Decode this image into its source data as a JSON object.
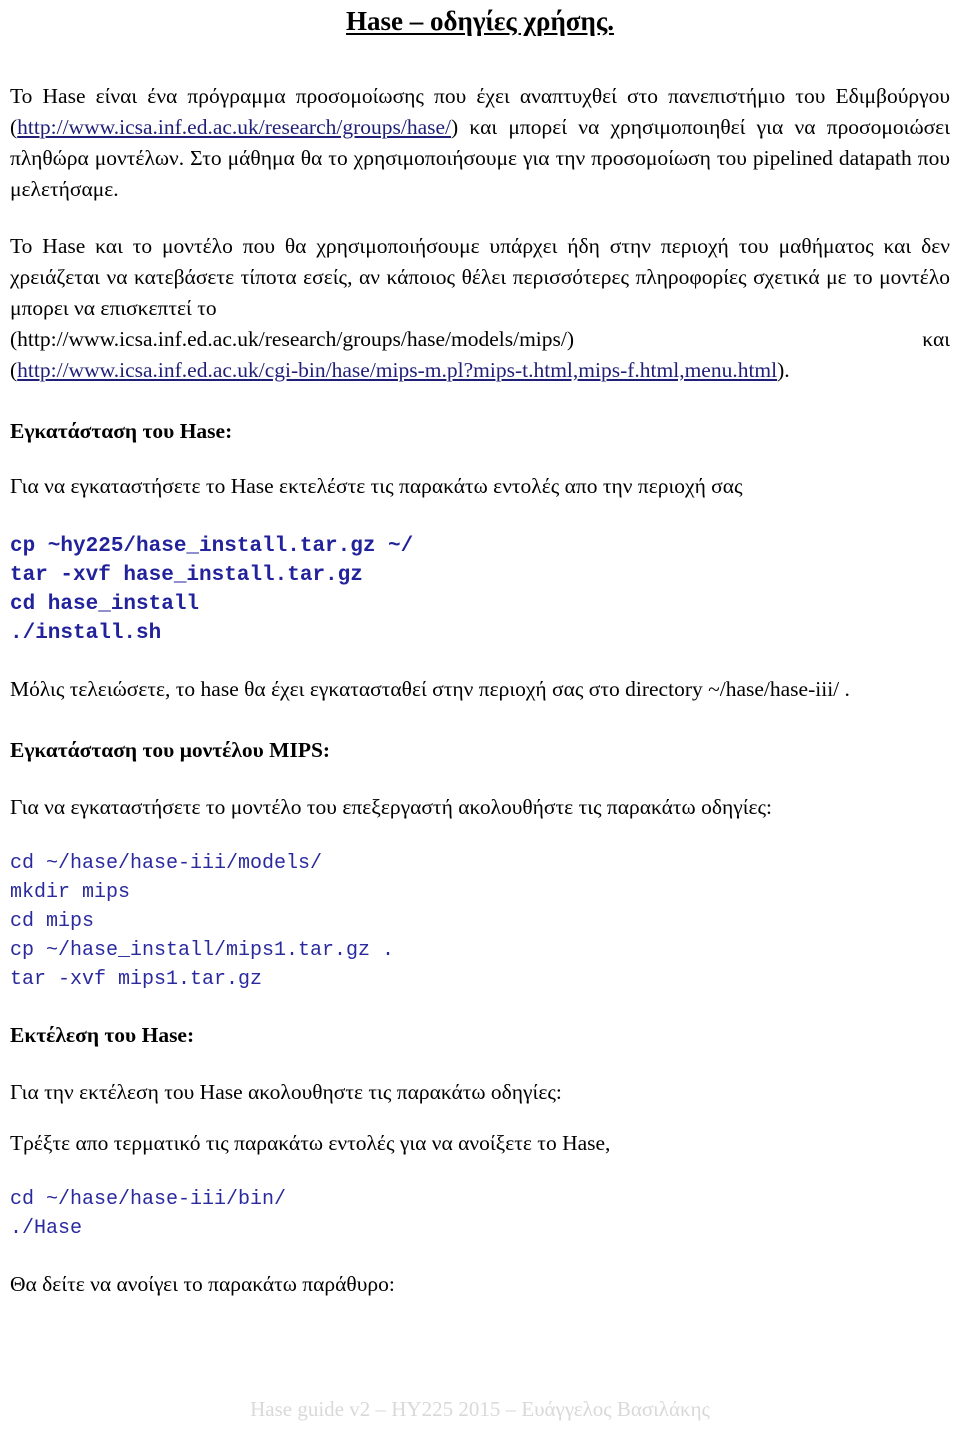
{
  "document": {
    "title": "Hase – οδηγίες χρήσης."
  },
  "intro": {
    "part1": "Το Hase είναι ένα πρόγραμμα προσομοίωσης που έχει αναπτυχθεί στο πανεπιστήμιο του Εδιμβούργου (",
    "link1": "http://www.icsa.inf.ed.ac.uk/research/groups/hase/",
    "part2": ") και μπορεί να χρησιμοποιηθεί για να προσομοιώσει πληθώρα μοντέλων. Στο μάθημα θα το χρησιμοποιήσουμε για την προσομοίωση του pipelined datapath που μελετήσαμε."
  },
  "model_info": {
    "part1": "Το Hase και το μοντέλο που θα χρησιμοποιήσουμε υπάρχει ήδη στην περιοχή του μαθήματος και δεν χρειάζεται να κατεβάσετε τίποτα εσείς, αν κάποιος θέλει περισσότερες πληροφορίες σχετικά με το μοντέλο μπορει να επισκεπτεί το",
    "url_plain": "(http://www.icsa.inf.ed.ac.uk/research/groups/hase/models/mips/)",
    "connector": "και",
    "url_link": "http://www.icsa.inf.ed.ac.uk/cgi-bin/hase/mips-m.pl?mips-t.html,mips-f.html,menu.html",
    "url_open_paren": "(",
    "url_close_paren": ")."
  },
  "install_hase": {
    "heading": "Εγκατάσταση του Hase:",
    "instruction": "Για να εγκαταστήσετε το Hase εκτελέστε τις παρακάτω εντολές απο την περιοχή σας",
    "commands": [
      "cp ~hy225/hase_install.tar.gz ~/",
      "tar -xvf hase_install.tar.gz",
      "cd hase_install",
      "./install.sh"
    ],
    "after": "Μόλις τελειώσετε, το hase θα έχει εγκατασταθεί στην περιοχή σας στο directory ~/hase/hase-iii/ ."
  },
  "install_mips": {
    "heading": "Εγκατάσταση του μοντέλου MIPS:",
    "instruction": "Για να εγκαταστήσετε το μοντέλο του επεξεργαστή ακολουθήστε τις παρακάτω οδηγίες:",
    "commands": [
      "cd ~/hase/hase-iii/models/",
      "mkdir mips",
      "cd mips",
      "cp ~/hase_install/mips1.tar.gz .",
      "tar -xvf mips1.tar.gz"
    ]
  },
  "run_hase": {
    "heading": "Εκτέλεση του Hase:",
    "instruction": "Για την εκτέλεση του Hase ακολουθηστε τις παρακάτω οδηγίες:",
    "terminal_note": "Τρέξτε απο τερματικό τις παρακάτω εντολές για να ανοίξετε το Hase,",
    "commands": [
      "cd ~/hase/hase-iii/bin/",
      "./Hase"
    ],
    "closing": "Θα δείτε να ανοίγει το παρακάτω παράθυρο:"
  },
  "footer": {
    "text": "Hase guide v2 – HY225 2015 –  Ευάγγελος Βασιλάκης"
  },
  "colors": {
    "link": "#1f1f78",
    "code": "#22229c",
    "footer": "#d9d9d9",
    "text": "#000000"
  }
}
